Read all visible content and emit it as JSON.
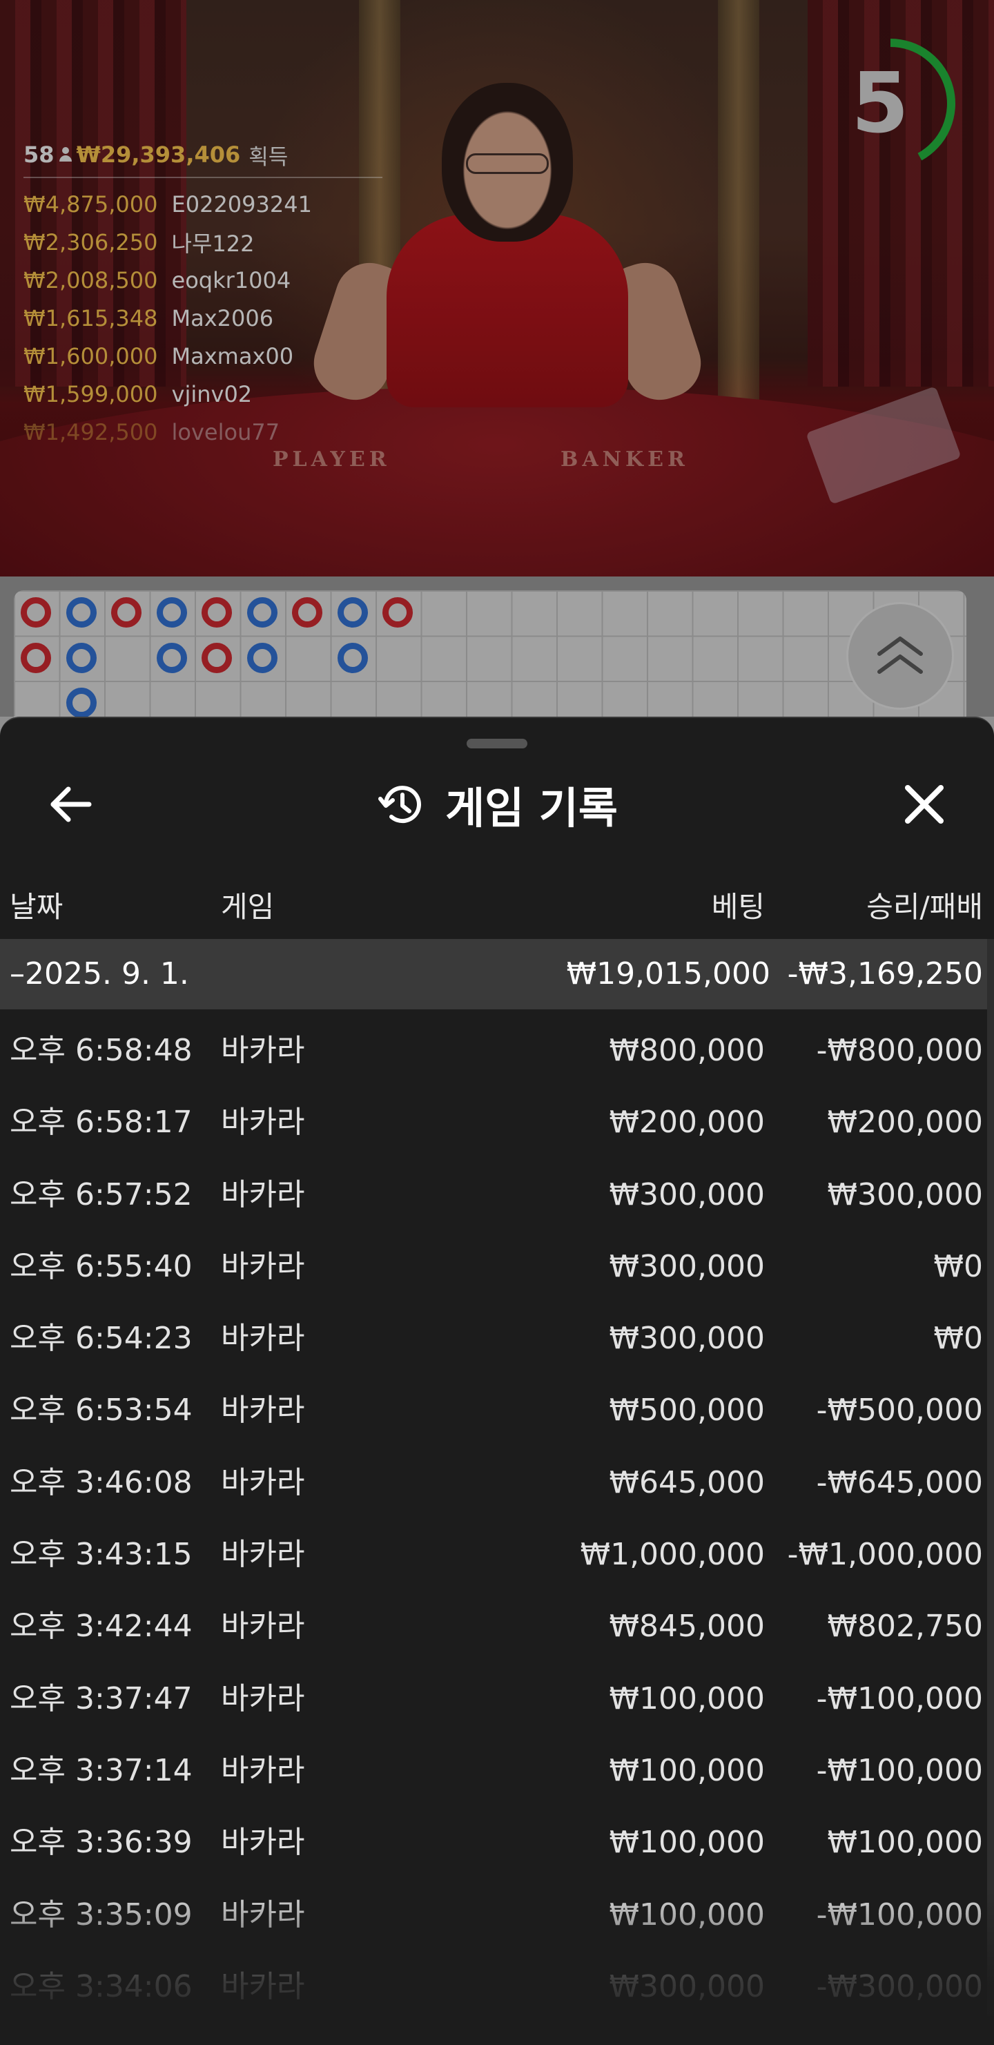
{
  "countdown": {
    "value": "5",
    "progress": 0.42,
    "color": "#22a83a"
  },
  "leaderboard": {
    "player_count": "58",
    "total": "₩29,393,406",
    "total_suffix": "획득",
    "entries": [
      {
        "amount": "₩4,875,000",
        "user": "E022093241"
      },
      {
        "amount": "₩2,306,250",
        "user": "나무122"
      },
      {
        "amount": "₩2,008,500",
        "user": "eoqkr1004"
      },
      {
        "amount": "₩1,615,348",
        "user": "Max2006"
      },
      {
        "amount": "₩1,600,000",
        "user": "Maxmax00"
      },
      {
        "amount": "₩1,599,000",
        "user": "vjinv02"
      },
      {
        "amount": "₩1,492,500",
        "user": "lovelou77"
      }
    ]
  },
  "table_labels": {
    "player": "PLAYER",
    "banker": "BANKER"
  },
  "roadmap": {
    "colors": {
      "red": "#c0272d",
      "blue": "#2f6ac4"
    },
    "columns": [
      [
        "red",
        "red"
      ],
      [
        "blue",
        "blue",
        "blue"
      ],
      [
        "red"
      ],
      [
        "blue",
        "blue"
      ],
      [
        "red",
        "red"
      ],
      [
        "blue",
        "blue"
      ],
      [
        "red"
      ],
      [
        "blue",
        "blue"
      ],
      [
        "red"
      ]
    ]
  },
  "panel": {
    "title": "게임 기록",
    "headers": {
      "date": "날짜",
      "game": "게임",
      "bet": "베팅",
      "win_loss": "승리/패배"
    },
    "summary": {
      "date": "–2025. 9. 1.",
      "bet": "₩19,015,000",
      "win_loss": "-₩3,169,250"
    },
    "rows": [
      {
        "time": "오후 6:58:48",
        "game": "바카라",
        "bet": "₩800,000",
        "win_loss": "-₩800,000"
      },
      {
        "time": "오후 6:58:17",
        "game": "바카라",
        "bet": "₩200,000",
        "win_loss": "₩200,000"
      },
      {
        "time": "오후 6:57:52",
        "game": "바카라",
        "bet": "₩300,000",
        "win_loss": "₩300,000"
      },
      {
        "time": "오후 6:55:40",
        "game": "바카라",
        "bet": "₩300,000",
        "win_loss": "₩0"
      },
      {
        "time": "오후 6:54:23",
        "game": "바카라",
        "bet": "₩300,000",
        "win_loss": "₩0"
      },
      {
        "time": "오후 6:53:54",
        "game": "바카라",
        "bet": "₩500,000",
        "win_loss": "-₩500,000"
      },
      {
        "time": "오후 3:46:08",
        "game": "바카라",
        "bet": "₩645,000",
        "win_loss": "-₩645,000"
      },
      {
        "time": "오후 3:43:15",
        "game": "바카라",
        "bet": "₩1,000,000",
        "win_loss": "-₩1,000,000"
      },
      {
        "time": "오후 3:42:44",
        "game": "바카라",
        "bet": "₩845,000",
        "win_loss": "₩802,750"
      },
      {
        "time": "오후 3:37:47",
        "game": "바카라",
        "bet": "₩100,000",
        "win_loss": "-₩100,000"
      },
      {
        "time": "오후 3:37:14",
        "game": "바카라",
        "bet": "₩100,000",
        "win_loss": "-₩100,000"
      },
      {
        "time": "오후 3:36:39",
        "game": "바카라",
        "bet": "₩100,000",
        "win_loss": "₩100,000"
      },
      {
        "time": "오후 3:35:09",
        "game": "바카라",
        "bet": "₩100,000",
        "win_loss": "-₩100,000"
      },
      {
        "time": "오후 3:34:06",
        "game": "바카라",
        "bet": "₩300,000",
        "win_loss": "-₩300,000"
      }
    ]
  }
}
